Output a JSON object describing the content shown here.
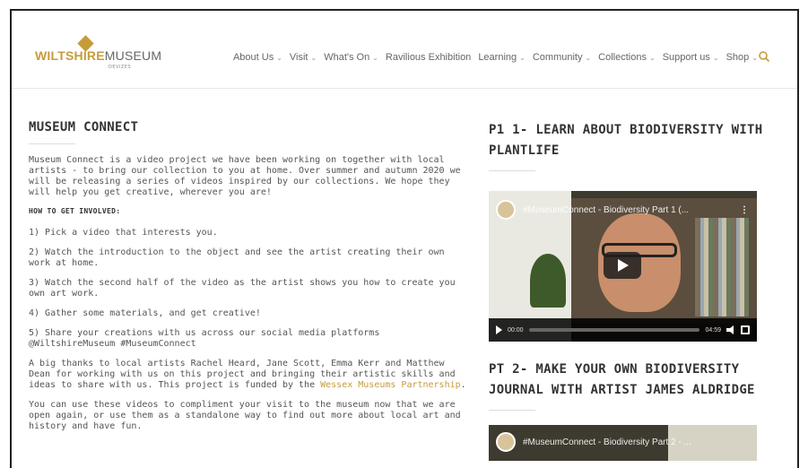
{
  "header": {
    "logo": {
      "primary": "WILTSHIRE",
      "secondary": "MUSEUM",
      "sub": "DEVIZES"
    },
    "nav": [
      {
        "label": "About Us",
        "dropdown": true
      },
      {
        "label": "Visit",
        "dropdown": true
      },
      {
        "label": "What's On",
        "dropdown": true
      },
      {
        "label": "Ravilious Exhibition",
        "dropdown": false
      },
      {
        "label": "Learning",
        "dropdown": true
      },
      {
        "label": "Community",
        "dropdown": true
      },
      {
        "label": "Collections",
        "dropdown": true
      },
      {
        "label": "Support us",
        "dropdown": true
      },
      {
        "label": "Shop",
        "dropdown": true
      }
    ],
    "search_icon": "search-icon"
  },
  "main": {
    "title": "MUSEUM CONNECT",
    "intro": "Museum Connect is a video project we have been working on together with local artists - to bring our collection to you at home. Over summer and autumn 2020 we will be releasing a series of videos inspired by our collections. We hope they will help you get creative, wherever you are!",
    "how_heading": "HOW TO GET INVOLVED:",
    "steps": [
      "1) Pick a video that interests you.",
      "2) Watch the introduction to the object and see the artist creating their own work at home.",
      "3) Watch the second half of the video as the artist shows you how to create you own art work.",
      "4) Gather some materials, and get creative!",
      "5) Share your creations with us across our social media platforms @WiltshireMuseum #MuseumConnect"
    ],
    "thanks_before": "A big thanks to local artists Rachel Heard, Jane Scott, Emma Kerr and Matthew Dean for working with us on this project and bringing their artistic skills and ideas to share with us. This project is funded by the ",
    "thanks_link": "Wessex Museums Partnership",
    "thanks_after": ".",
    "closing": "You can use these videos to compliment your visit to the museum now that we are open again, or use them as a standalone way to find out more about local art and history and have fun."
  },
  "sidebar": {
    "part1": {
      "title": "P1 1- LEARN ABOUT BIODIVERSITY WITH PLANTLIFE",
      "video_title": "#MuseumConnect - Biodiversity Part 1 (...",
      "time_current": "00:00",
      "time_total": "04:59"
    },
    "part2": {
      "title": "PT 2- MAKE YOUR OWN BIODIVERSITY JOURNAL WITH ARTIST JAMES ALDRIDGE",
      "video_title": "#MuseumConnect - Biodiversity Part 2 - ..."
    }
  },
  "colors": {
    "accent": "#c69c3b",
    "text": "#555555",
    "heading": "#333333"
  }
}
